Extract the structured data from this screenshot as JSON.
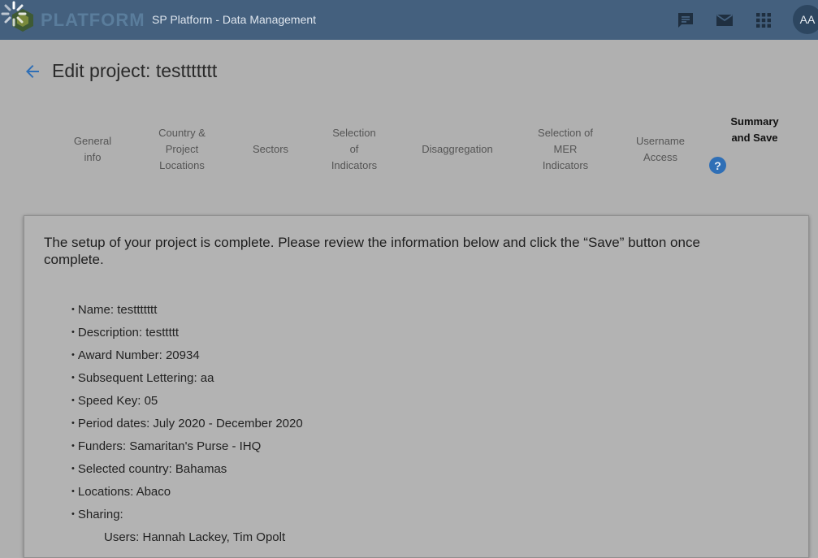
{
  "header": {
    "logo_text": "PLATFORM",
    "app_title": "SP Platform - Data Management",
    "avatar_initials": "AA",
    "colors": {
      "bar": "#44607e",
      "accent": "#2f6fb6"
    }
  },
  "page": {
    "title": "Edit project: testtttttt"
  },
  "stepper": {
    "steps": [
      {
        "label": "General\ninfo"
      },
      {
        "label": "Country &\nProject\nLocations"
      },
      {
        "label": "Sectors"
      },
      {
        "label": "Selection\nof\nIndicators"
      },
      {
        "label": "Disaggregation"
      },
      {
        "label": "Selection of\nMER\nIndicators"
      },
      {
        "label": "Username\nAccess"
      },
      {
        "label": "Summary\nand Save"
      }
    ],
    "active_index": 7,
    "help_glyph": "?"
  },
  "summary": {
    "intro": "The setup of your project is complete. Please review the information below and click the “Save” button once complete.",
    "items": [
      "Name: testtttttt",
      "Description: testtttt",
      "Award Number: 20934",
      "Subsequent Lettering: aa",
      "Speed Key: 05",
      "Period dates: July 2020 - December 2020",
      "Funders: Samaritan's Purse - IHQ",
      "Selected country: Bahamas",
      "Locations: Abaco",
      "Sharing:"
    ],
    "sharing_users": "Users: Hannah Lackey, Tim Opolt"
  },
  "icons": [
    "loading-spinner-icon",
    "logo-icon",
    "chat-icon",
    "mail-icon",
    "apps-grid-icon",
    "arrow-back-icon",
    "help-icon"
  ]
}
